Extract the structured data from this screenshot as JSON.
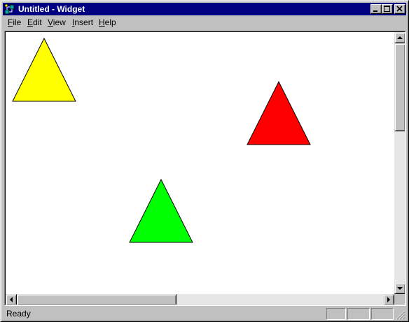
{
  "window": {
    "title": "Untitled - Widget",
    "app_icon": "widget-app-icon",
    "caption_buttons": [
      "minimize-icon",
      "maximize-icon",
      "close-icon"
    ]
  },
  "menu": {
    "items": [
      {
        "hotkey": "F",
        "rest": "ile"
      },
      {
        "hotkey": "E",
        "rest": "dit"
      },
      {
        "hotkey": "V",
        "rest": "iew"
      },
      {
        "hotkey": "I",
        "rest": "nsert"
      },
      {
        "hotkey": "H",
        "rest": "elp"
      }
    ]
  },
  "canvas": {
    "shapes": [
      {
        "type": "triangle",
        "color": "yellow",
        "fill": "#ffff00"
      },
      {
        "type": "triangle",
        "color": "red",
        "fill": "#ff0000"
      },
      {
        "type": "triangle",
        "color": "green",
        "fill": "#00ff00"
      }
    ]
  },
  "scrollbars": {
    "vertical": {
      "position": 0,
      "visible_fraction": 0.38
    },
    "horizontal": {
      "position": 0,
      "visible_fraction": 0.47
    }
  },
  "status": {
    "text": "Ready"
  }
}
